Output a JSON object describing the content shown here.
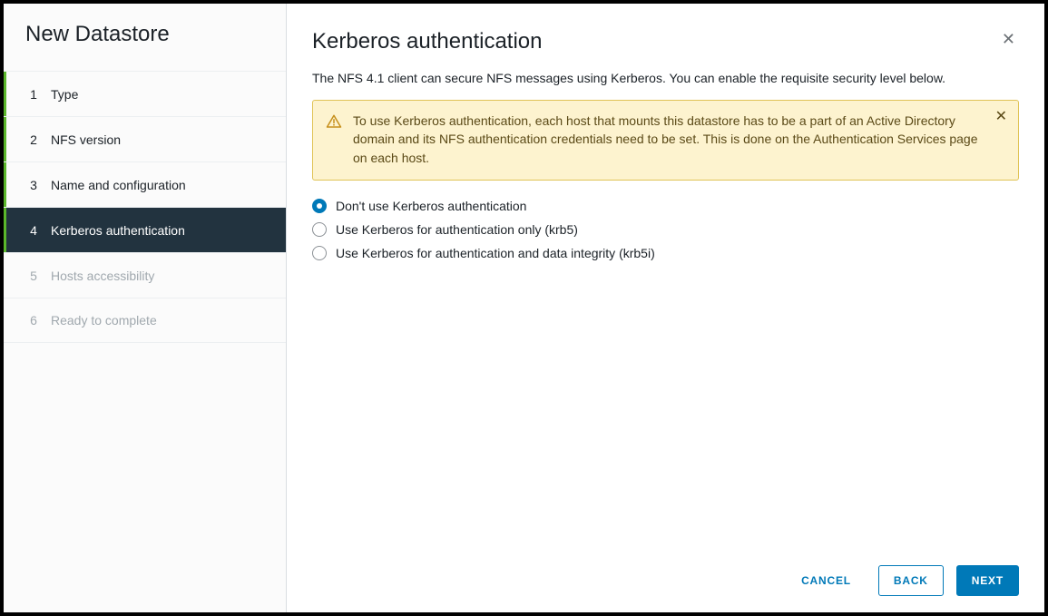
{
  "wizard": {
    "title": "New Datastore",
    "steps": [
      {
        "num": "1",
        "label": "Type",
        "state": "visited"
      },
      {
        "num": "2",
        "label": "NFS version",
        "state": "visited"
      },
      {
        "num": "3",
        "label": "Name and configuration",
        "state": "visited"
      },
      {
        "num": "4",
        "label": "Kerberos authentication",
        "state": "active"
      },
      {
        "num": "5",
        "label": "Hosts accessibility",
        "state": "future"
      },
      {
        "num": "6",
        "label": "Ready to complete",
        "state": "future"
      }
    ]
  },
  "page": {
    "title": "Kerberos authentication",
    "description": "The NFS 4.1 client can secure NFS messages using Kerberos. You can enable the requisite security level below."
  },
  "alert": {
    "text": "To use Kerberos authentication, each host that mounts this datastore has to be a part of an Active Directory domain and its NFS authentication credentials need to be set. This is done on the Authentication Services page on each host."
  },
  "options": {
    "none": "Don't use Kerberos authentication",
    "krb5": "Use Kerberos for authentication only (krb5)",
    "krb5i": "Use Kerberos for authentication and data integrity (krb5i)",
    "selected": "none"
  },
  "footer": {
    "cancel": "CANCEL",
    "back": "BACK",
    "next": "NEXT"
  }
}
